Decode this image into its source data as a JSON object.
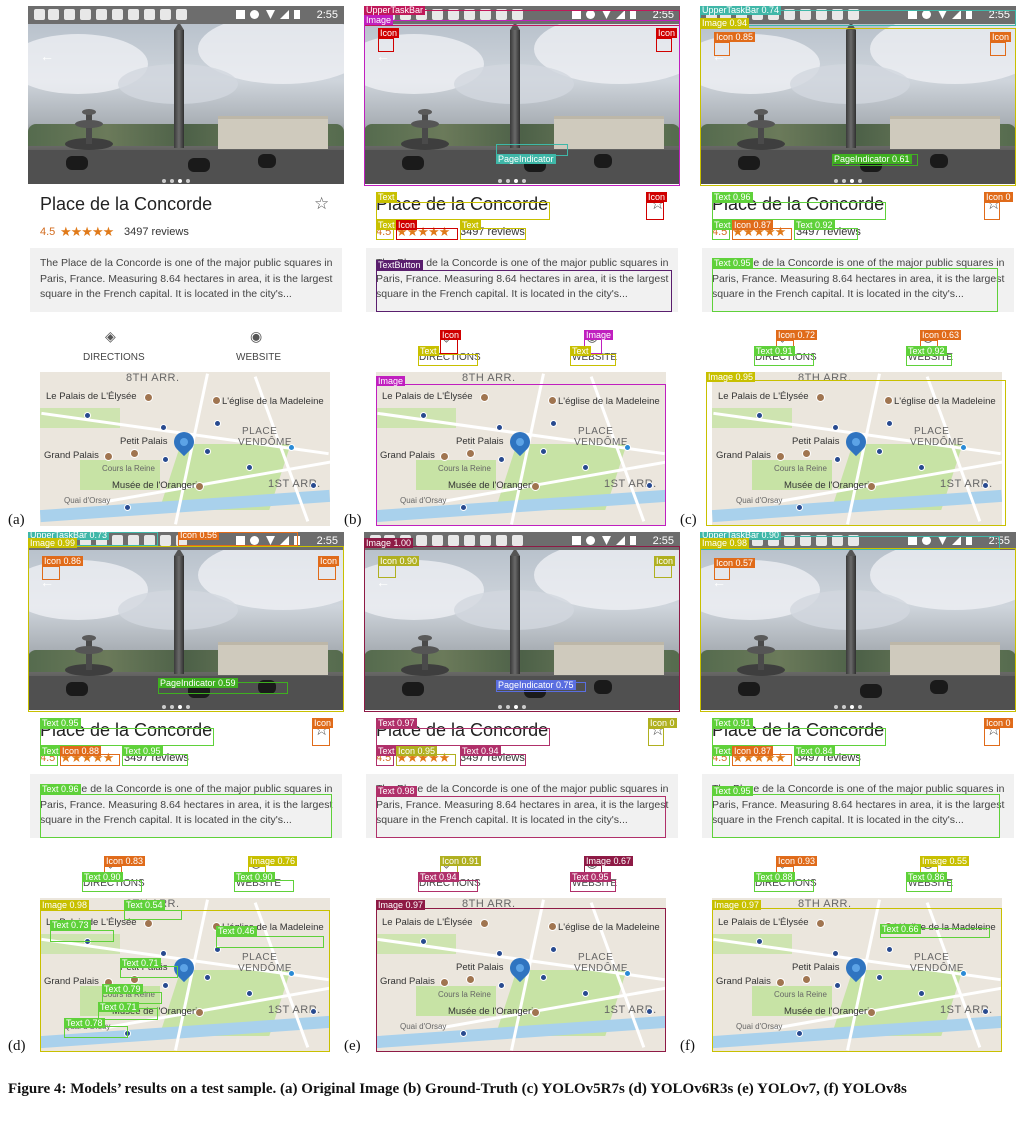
{
  "figure": {
    "caption": "Figure 4: Models’ results on a test sample. (a) Original Image (b) Ground-Truth (c) YOLOv5R7s (d) YOLOv6R3s (e) YOLOv7, (f) YOLOv8s"
  },
  "screen": {
    "time": "2:55",
    "place_title": "Place de la Concorde",
    "rating": "4.5",
    "stars": "★★★★★",
    "reviews": "3497 reviews",
    "description": "The Place de la Concorde is one of the major public squares in Paris, France. Measuring 8.64 hectares in area, it is the largest square in the French capital. It is located in the city's...",
    "directions_label": "DIRECTIONS",
    "website_label": "WEBSITE",
    "star_icon": "☆",
    "directions_icon": "◈",
    "website_icon": "◉",
    "back_icon": "←",
    "map": {
      "arr8": "8TH ARR.",
      "arr1": "1ST ARR.",
      "elysee": "Le Palais de L'Élysée",
      "madeleine": "L'église de la Madeleine",
      "place_vendome_1": "PLACE",
      "place_vendome_2": "VENDÔME",
      "petit_palais": "Petit Palais",
      "grand_palais": "Grand Palais",
      "cours_reine": "Cours la Reine",
      "orangerie": "Musée de l'Orangerie",
      "quai": "Quai d'Orsay"
    }
  },
  "panels": [
    {
      "label": "(a)",
      "detections": []
    },
    {
      "label": "(b)",
      "color_default": "#c0185a",
      "detections": [
        {
          "text": "UpperTaskBar",
          "color": "#c0185a"
        },
        {
          "text": "Image",
          "color": "#c01fbf"
        },
        {
          "text": "Icon",
          "color": "#d00000"
        },
        {
          "text": "Icon",
          "color": "#d00000"
        },
        {
          "text": "PageIndicator",
          "color": "#3fb7a8"
        },
        {
          "text": "Text",
          "color": "#c8c000"
        },
        {
          "text": "Icon",
          "color": "#d00000"
        },
        {
          "text": "Text",
          "color": "#c8c000"
        },
        {
          "text": "Icon",
          "color": "#d00000"
        },
        {
          "text": "Text",
          "color": "#c8c000"
        },
        {
          "text": "TextButton",
          "color": "#5a1e6e"
        },
        {
          "text": "Icon",
          "color": "#d00000"
        },
        {
          "text": "Image",
          "color": "#c01fbf"
        },
        {
          "text": "Text",
          "color": "#c8c000"
        },
        {
          "text": "Text",
          "color": "#c8c000"
        },
        {
          "text": "Image",
          "color": "#c01fbf"
        }
      ]
    },
    {
      "label": "(c)",
      "detections": [
        {
          "text": "UpperTaskBar 0.74",
          "color": "#3fb7a8"
        },
        {
          "text": "Image 0.94",
          "color": "#c8c000"
        },
        {
          "text": "Icon 0.85",
          "color": "#e06b1a"
        },
        {
          "text": "Icon",
          "color": "#e06b1a"
        },
        {
          "text": "PageIndicator 0.61",
          "color": "#3fb020"
        },
        {
          "text": "Text 0.96",
          "color": "#5fd13a"
        },
        {
          "text": "Icon 0",
          "color": "#e06b1a"
        },
        {
          "text": "Text 0.87",
          "color": "#5fd13a"
        },
        {
          "text": "Icon 0.87",
          "color": "#e06b1a"
        },
        {
          "text": "Text 0.92",
          "color": "#5fd13a"
        },
        {
          "text": "Text 0.95",
          "color": "#5fd13a"
        },
        {
          "text": "Icon 0.72",
          "color": "#e06b1a"
        },
        {
          "text": "Icon 0.63",
          "color": "#e06b1a"
        },
        {
          "text": "Text 0.91",
          "color": "#5fd13a"
        },
        {
          "text": "Text 0.92",
          "color": "#5fd13a"
        },
        {
          "text": "Image 0.95",
          "color": "#c8c000"
        }
      ]
    },
    {
      "label": "(d)",
      "detections": [
        {
          "text": "UpperTaskBar 0.73",
          "color": "#3fb7a8"
        },
        {
          "text": "Icon 0.56",
          "color": "#e06b1a"
        },
        {
          "text": "Image 0.99",
          "color": "#c8c000"
        },
        {
          "text": "Icon 0.86",
          "color": "#e06b1a"
        },
        {
          "text": "Icon",
          "color": "#e06b1a"
        },
        {
          "text": "PageIndicator 0.59",
          "color": "#3fb020"
        },
        {
          "text": "Text 0.95",
          "color": "#5fd13a"
        },
        {
          "text": "Icon",
          "color": "#e06b1a"
        },
        {
          "text": "Text",
          "color": "#5fd13a"
        },
        {
          "text": "Icon 0.88",
          "color": "#e06b1a"
        },
        {
          "text": "Text 0.95",
          "color": "#5fd13a"
        },
        {
          "text": "Text 0.96",
          "color": "#5fd13a"
        },
        {
          "text": "Icon 0.83",
          "color": "#e06b1a"
        },
        {
          "text": "Image 0.76",
          "color": "#c8c000"
        },
        {
          "text": "Text 0.90",
          "color": "#5fd13a"
        },
        {
          "text": "Text 0.90",
          "color": "#5fd13a"
        },
        {
          "text": "Image 0.98",
          "color": "#c8c000"
        },
        {
          "text": "Text 0.54",
          "color": "#5fd13a"
        },
        {
          "text": "Text 0.73",
          "color": "#5fd13a"
        },
        {
          "text": "Text 0.46",
          "color": "#5fd13a"
        },
        {
          "text": "Text 0.71",
          "color": "#5fd13a"
        },
        {
          "text": "Text 0.79",
          "color": "#5fd13a"
        },
        {
          "text": "Text 0.71",
          "color": "#5fd13a"
        },
        {
          "text": "Text 0.78",
          "color": "#5fd13a"
        }
      ]
    },
    {
      "label": "(e)",
      "detections": [
        {
          "text": "Image 1.00",
          "color": "#8e1a45"
        },
        {
          "text": "Icon 0.90",
          "color": "#b0b020"
        },
        {
          "text": "Icon",
          "color": "#b0b020"
        },
        {
          "text": "PageIndicator 0.75",
          "color": "#5a6ee0"
        },
        {
          "text": "Text 0.97",
          "color": "#b0306a"
        },
        {
          "text": "Icon 0",
          "color": "#b0b020"
        },
        {
          "text": "Text",
          "color": "#b0306a"
        },
        {
          "text": "Icon 0.95",
          "color": "#b0b020"
        },
        {
          "text": "Text 0.94",
          "color": "#b0306a"
        },
        {
          "text": "Text 0.98",
          "color": "#b0306a"
        },
        {
          "text": "Icon 0.91",
          "color": "#b0b020"
        },
        {
          "text": "Image 0.67",
          "color": "#8e1a45"
        },
        {
          "text": "Text 0.94",
          "color": "#b0306a"
        },
        {
          "text": "Text 0.95",
          "color": "#b0306a"
        },
        {
          "text": "Image 0.97",
          "color": "#8e1a45"
        }
      ]
    },
    {
      "label": "(f)",
      "detections": [
        {
          "text": "UpperTaskBar 0.90",
          "color": "#3fb7a8"
        },
        {
          "text": "Image 0.98",
          "color": "#c8c000"
        },
        {
          "text": "Icon 0.57",
          "color": "#e06b1a"
        },
        {
          "text": "Text 0.91",
          "color": "#5fd13a"
        },
        {
          "text": "Icon 0",
          "color": "#e06b1a"
        },
        {
          "text": "Text",
          "color": "#5fd13a"
        },
        {
          "text": "Icon 0.87",
          "color": "#e06b1a"
        },
        {
          "text": "Text 0.84",
          "color": "#5fd13a"
        },
        {
          "text": "Text 0.95",
          "color": "#5fd13a"
        },
        {
          "text": "Icon 0.93",
          "color": "#e06b1a"
        },
        {
          "text": "Image 0.55",
          "color": "#c8c000"
        },
        {
          "text": "Text 0.88",
          "color": "#5fd13a"
        },
        {
          "text": "Text 0.86",
          "color": "#5fd13a"
        },
        {
          "text": "Image 0.97",
          "color": "#c8c000"
        },
        {
          "text": "Text 0.66",
          "color": "#5fd13a"
        }
      ]
    }
  ]
}
